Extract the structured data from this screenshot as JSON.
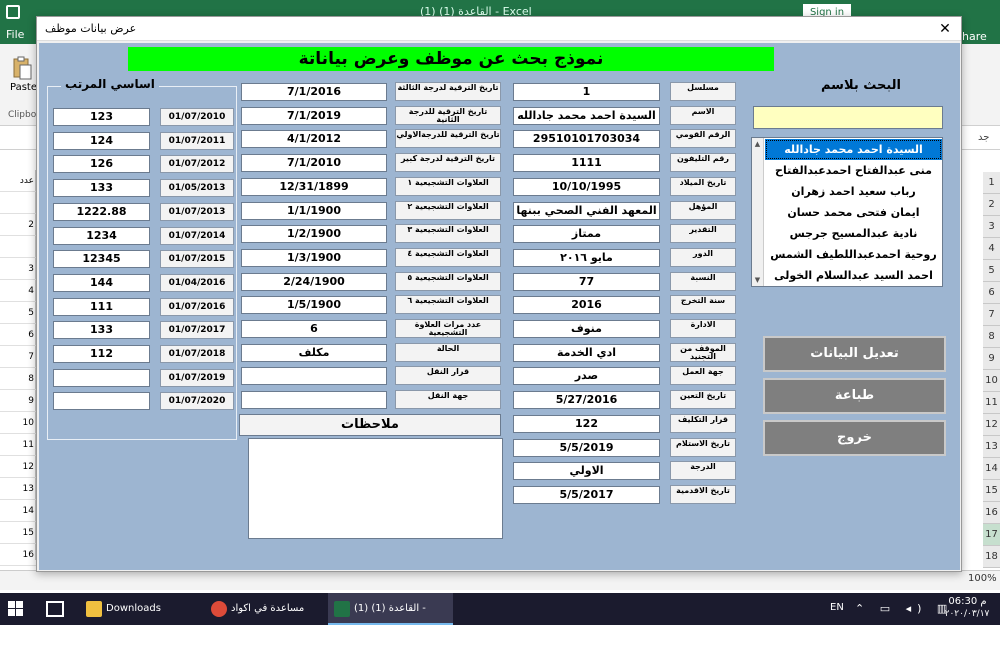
{
  "excel": {
    "title": "القاعدة (1) (1)  -  Excel",
    "sign_in": "Sign in",
    "file_tab": "File",
    "share": "hare",
    "paste": "Paste",
    "clipboard": "Clipbo",
    "font_hint": "جد",
    "row_numbers": [
      "1",
      "2",
      "3",
      "4",
      "5",
      "6",
      "7",
      "8",
      "9",
      "10",
      "11",
      "12",
      "13",
      "14",
      "15",
      "16",
      "17",
      "18"
    ],
    "left_col_values": [
      "عدد",
      "",
      "2",
      "",
      "3",
      "4",
      "5",
      "6",
      "7",
      "8",
      "9",
      "10",
      "11",
      "12",
      "13",
      "14",
      "15",
      "16"
    ],
    "zoom": "100%"
  },
  "taskbar": {
    "items": [
      {
        "label": "Downloads",
        "color": "#f0c040"
      },
      {
        "label": "مساعدة في اكواد الا...",
        "color": "#dd4b39"
      },
      {
        "label": "القاعدة (1) (1) - Excel",
        "color": "#217346"
      }
    ],
    "lang": "EN",
    "tray": "⌃ ▭ ◂) ▥",
    "time": "06:30 م",
    "date": "٢٠٢٠/٠٣/١٧"
  },
  "dialog": {
    "title": "عرض بيانات موظف",
    "close": "✕",
    "banner": "نموذج بحث عن موظف وعرض بياناتة",
    "search": {
      "title": "البحث بلاسم",
      "input_value": "",
      "names": [
        "السيدة احمد محمد جادالله",
        "منى عبدالفتاح احمدعبدالفتاح",
        "رباب سعيد احمد زهران",
        "ايمان فتحى محمد حسان",
        "نادية عبدالمسيح جرجس",
        "روحية احمدعبداللطيف الشمس",
        "احمد السيد عبدالسلام الخولى"
      ]
    },
    "buttons": {
      "edit": "تعديل البيانات",
      "print": "طباعة",
      "exit": "خروج"
    },
    "personal_fields": [
      {
        "label": "مسلسل",
        "value": "1"
      },
      {
        "label": "الاسم",
        "value": "السيدة احمد محمد جادالله"
      },
      {
        "label": "الرقم القومي",
        "value": "29510101703034"
      },
      {
        "label": "رقم التليفون",
        "value": "1111"
      },
      {
        "label": "تاريخ الميلاد",
        "value": "10/10/1995"
      },
      {
        "label": "المؤهل",
        "value": "المعهد الفني الصحي ببنها"
      },
      {
        "label": "التقدير",
        "value": "ممتاز"
      },
      {
        "label": "الدور",
        "value": "مايو ٢٠١٦"
      },
      {
        "label": "النسبة",
        "value": "77"
      },
      {
        "label": "سنة التخرج",
        "value": "2016"
      },
      {
        "label": "الادارة",
        "value": "منوف"
      },
      {
        "label": "الموقف من التجنيد",
        "value": "ادي الخدمة"
      },
      {
        "label": "جهة العمل",
        "value": "صدر"
      },
      {
        "label": "تاريخ التعين",
        "value": "5/27/2016"
      },
      {
        "label": "قرار التكليف",
        "value": "122"
      },
      {
        "label": "تاريخ الاستلام",
        "value": "5/5/2019"
      },
      {
        "label": "الدرجة",
        "value": "الاولي"
      },
      {
        "label": "تاريخ الاقدمية",
        "value": "5/5/2017"
      }
    ],
    "promo_fields": [
      {
        "label": "تاريخ الترقية لدرجة الثالثة",
        "value": "7/1/2016"
      },
      {
        "label": "تاريخ الترقية للدرجة الثانية",
        "value": "7/1/2019"
      },
      {
        "label": "تاريخ الترقية للدرجةالاولي",
        "value": "4/1/2012"
      },
      {
        "label": "تاريخ الترقية لدرجة كبير",
        "value": "7/1/2010"
      },
      {
        "label": "العلاوات التشجيعية ١",
        "value": "12/31/1899"
      },
      {
        "label": "العلاوات التشجيعية ٢",
        "value": "1/1/1900"
      },
      {
        "label": "العلاوات التشجيعية ٣",
        "value": "1/2/1900"
      },
      {
        "label": "العلاوات التشجيعية ٤",
        "value": "1/3/1900"
      },
      {
        "label": "العلاوات التشجيعية ٥",
        "value": "2/24/1900"
      },
      {
        "label": "العلاوات التشجيعية ٦",
        "value": "1/5/1900"
      },
      {
        "label": "عدد مرات العلاوة التشجيعية",
        "value": "6"
      },
      {
        "label": "الحالة",
        "value": "مكلف"
      },
      {
        "label": "قرار النقل",
        "value": ""
      },
      {
        "label": "جهة النقل",
        "value": ""
      }
    ],
    "salary": {
      "legend": "اساسي المرتب",
      "rows": [
        {
          "date": "01/07/2010",
          "value": "123"
        },
        {
          "date": "01/07/2011",
          "value": "124"
        },
        {
          "date": "01/07/2012",
          "value": "126"
        },
        {
          "date": "01/05/2013",
          "value": "133"
        },
        {
          "date": "01/07/2013",
          "value": "1222.88"
        },
        {
          "date": "01/07/2014",
          "value": "1234"
        },
        {
          "date": "01/07/2015",
          "value": "12345"
        },
        {
          "date": "01/04/2016",
          "value": "144"
        },
        {
          "date": "01/07/2016",
          "value": "111"
        },
        {
          "date": "01/07/2017",
          "value": "133"
        },
        {
          "date": "01/07/2018",
          "value": "112"
        },
        {
          "date": "01/07/2019",
          "value": ""
        },
        {
          "date": "01/07/2020",
          "value": ""
        }
      ]
    },
    "notes": {
      "label": "ملاحظات",
      "value": ""
    }
  }
}
